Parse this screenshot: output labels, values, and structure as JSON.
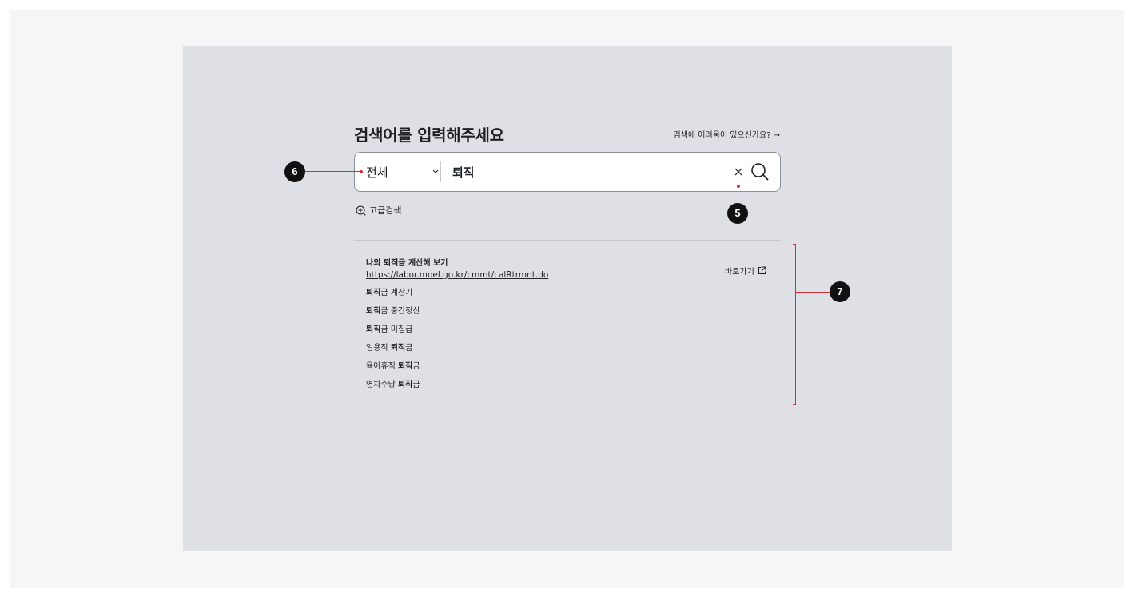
{
  "page": {
    "title": "검색어를 입력해주세요",
    "help_link": "검색에 어려움이 있으신가요?",
    "help_arrow": "→"
  },
  "search": {
    "scope": "전체",
    "query": "퇴직",
    "clear_icon": "close-icon",
    "search_icon": "search-icon"
  },
  "advanced": {
    "label": "고급검색",
    "icon": "zoom-in-icon"
  },
  "results": {
    "main": {
      "name": "나의 퇴직금 계산해 보기",
      "url": "https://labor.moel.go.kr/cmmt/calRtrmnt.do",
      "goto_label": "바로가기",
      "goto_icon": "external-link-icon"
    },
    "suggestions": [
      {
        "bold": "퇴직",
        "rest": "금 계산기"
      },
      {
        "bold": "퇴직",
        "rest": "금 중간정산"
      },
      {
        "bold": "퇴직",
        "rest": "금 미집급"
      },
      {
        "prefix": "일용직 ",
        "bold": "퇴직",
        "rest": "금"
      },
      {
        "prefix": "육아휴직 ",
        "bold": "퇴직",
        "rest": "금"
      },
      {
        "prefix": "연차수당 ",
        "bold": "퇴직",
        "rest": "금"
      }
    ]
  },
  "annotations": {
    "m5": "5",
    "m6": "6",
    "m7": "7"
  },
  "colors": {
    "canvas_bg": "#dee0e6",
    "outer_bg": "#f6f6f6",
    "annotation_red": "#d32f3a",
    "marker_black": "#111111"
  }
}
